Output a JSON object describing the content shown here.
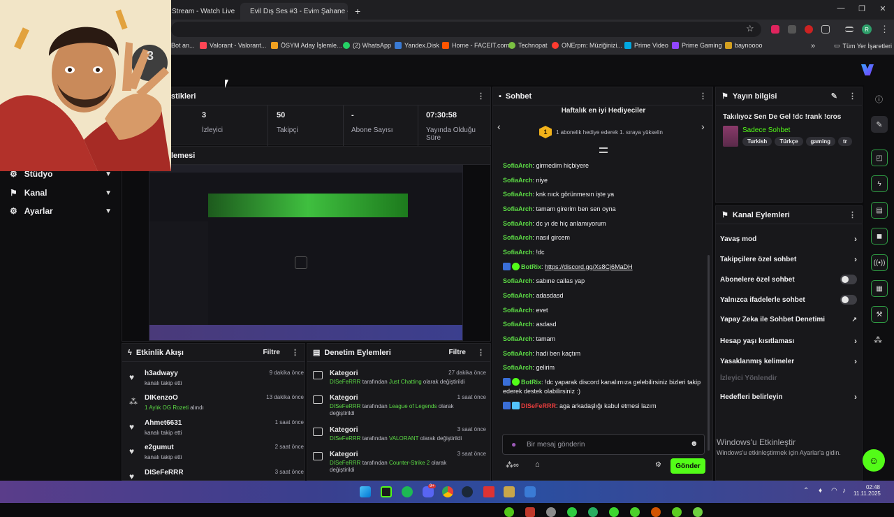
{
  "browser": {
    "tabs": [
      {
        "title": "Stream - Watch Live"
      },
      {
        "title": "Evil Dış Ses #3 - Evim Şahane -"
      }
    ],
    "new_tab": "+",
    "bookmarks": [
      "Bot an...",
      "Valorant - Valorant...",
      "ÖSYM Aday İşlemle...",
      "(2) WhatsApp",
      "Yandex.Disk",
      "Home - FACEIT.com",
      "Technopat",
      "ONErpm: Müziğinizi...",
      "Prime Video",
      "Prime Gaming",
      "baynoooo"
    ],
    "all_bookmarks": "Tüm Yer İşaretleri",
    "more": "»",
    "profile_initial": "R"
  },
  "stats": {
    "header": "stikleri",
    "items": [
      {
        "value": "3",
        "label": "İzleyici"
      },
      {
        "value": "50",
        "label": "Takipçi"
      },
      {
        "value": "-",
        "label": "Abone Sayısı"
      },
      {
        "value": "07:30:58",
        "label": "Yayında Olduğu Süre"
      }
    ]
  },
  "preview": {
    "header": "lemesi",
    "avatar_badge": "3"
  },
  "sidebar": {
    "items": [
      {
        "label": "Stüdyo"
      },
      {
        "label": "Kanal"
      },
      {
        "label": "Ayarlar"
      }
    ]
  },
  "activity": {
    "title": "Etkinlik Akışı",
    "filter": "Filtre",
    "events": [
      {
        "name": "h3adwayy",
        "detail": "kanalı takip etti",
        "time": "9 dakika önce",
        "icon": "heart-icon"
      },
      {
        "name": "DIKenzoO",
        "detail_green": "1 Aylık OG Rozeti",
        "detail": "alındı",
        "time": "13 dakika önce",
        "icon": "badge-icon"
      },
      {
        "name": "Ahmet6631",
        "detail": "kanalı takip etti",
        "time": "1 saat önce",
        "icon": "heart-icon"
      },
      {
        "name": "e2gumut",
        "detail": "kanalı takip etti",
        "time": "2 saat önce",
        "icon": "heart-icon"
      },
      {
        "name": "DISeFeRRR",
        "detail": "",
        "time": "3 saat önce",
        "icon": "heart-icon"
      }
    ]
  },
  "moderation": {
    "title": "Denetim Eylemleri",
    "filter": "Filtre",
    "actions": [
      {
        "title": "Kategori",
        "user": "DISeFeRRR",
        "mid": "tarafından",
        "category": "Just Chatting",
        "tail": "olarak değiştirildi",
        "time": "27 dakika önce"
      },
      {
        "title": "Kategori",
        "user": "DISeFeRRR",
        "mid": "tarafından",
        "category": "League of Legends",
        "tail": "olarak değiştirildi",
        "time": "1 saat önce"
      },
      {
        "title": "Kategori",
        "user": "DISeFeRRR",
        "mid": "tarafından",
        "category": "VALORANT",
        "tail": "olarak değiştirildi",
        "time": "3 saat önce"
      },
      {
        "title": "Kategori",
        "user": "DISeFeRRR",
        "mid": "tarafından",
        "category": "Counter-Strike 2",
        "tail": "olarak değiştirildi",
        "time": "3 saat önce"
      }
    ]
  },
  "chat": {
    "title": "Sohbet",
    "gifters_title": "Haftalık en iyi Hediyeciler",
    "gifters_rank": "1",
    "gifters_text": "1 abonelik hediye ederek 1. sıraya yükselin",
    "messages": [
      {
        "user": "SofiaArch",
        "text": "girmedim hiçbiyere"
      },
      {
        "user": "SofiaArch",
        "text": "niye"
      },
      {
        "user": "SofiaArch",
        "text": "knk nıck görünmesın işte ya"
      },
      {
        "user": "SofiaArch",
        "text": "tamam girerim ben sen oyna"
      },
      {
        "user": "SofiaArch",
        "text": "dc yı de hiç anlamıyorum"
      },
      {
        "user": "SofiaArch",
        "text": "nasıl gircem"
      },
      {
        "user": "SofiaArch",
        "text": "!dc"
      },
      {
        "user": "BotRix",
        "text": "https://discord.gg/Xs8Cj6MaDH",
        "bot": true
      },
      {
        "user": "SofiaArch",
        "text": "sabıne callas yap"
      },
      {
        "user": "SofiaArch",
        "text": "adasdasd"
      },
      {
        "user": "SofiaArch",
        "text": "evet"
      },
      {
        "user": "SofiaArch",
        "text": "asdasd"
      },
      {
        "user": "SofiaArch",
        "text": "tamam"
      },
      {
        "user": "SofiaArch",
        "text": "hadi ben kaçtım"
      },
      {
        "user": "SofiaArch",
        "text": "gelirim"
      },
      {
        "user": "BotRix",
        "text": "!dc yaparak discord kanalımıza gelebilirsiniz bizleri takip ederek destek olabilirsiniz :)",
        "bot": true
      },
      {
        "user": "DISeFeRRR",
        "text": "aga arkadaşlığı kabul etmesi lazım",
        "owner": true
      }
    ],
    "input_placeholder": "Bir mesaj gönderin",
    "send": "Gönder"
  },
  "stream_info": {
    "title": "Yayın bilgisi",
    "stream_title": "Takılıyoz Sen De Gel !dc !rank !cros",
    "category": "Sadece Sohbet",
    "tags": [
      "Turkish",
      "Türkçe",
      "gaming",
      "tr"
    ]
  },
  "channel_actions": {
    "title": "Kanal Eylemleri",
    "items": [
      {
        "label": "Yavaş mod",
        "control": "chevron"
      },
      {
        "label": "Takipçilere özel sohbet",
        "control": "chevron"
      },
      {
        "label": "Abonelere özel sohbet",
        "control": "toggle"
      },
      {
        "label": "Yalnızca ifadelerle sohbet",
        "control": "toggle"
      },
      {
        "label": "Yapay Zeka ile Sohbet Denetimi",
        "control": "external"
      },
      {
        "label": "Hesap yaşı kısıtlaması",
        "control": "chevron"
      },
      {
        "label": "Yasaklanmış kelimeler",
        "control": "chevron"
      },
      {
        "label": "İzleyici Yönlendir",
        "control": "disabled"
      },
      {
        "label": "Hedefleri belirleyin",
        "control": "chevron"
      }
    ]
  },
  "watermark": {
    "line1": "Windows'u Etkinleştir",
    "line2": "Windows'u etkinleştirmek için Ayarlar'a gidin."
  },
  "taskbar": {
    "time": "02:48",
    "date": "11.11.2025",
    "discord_badge": "9+"
  },
  "colors": {
    "accent": "#53fc18",
    "user": "#5cdb45",
    "owner": "#e63d3d"
  }
}
